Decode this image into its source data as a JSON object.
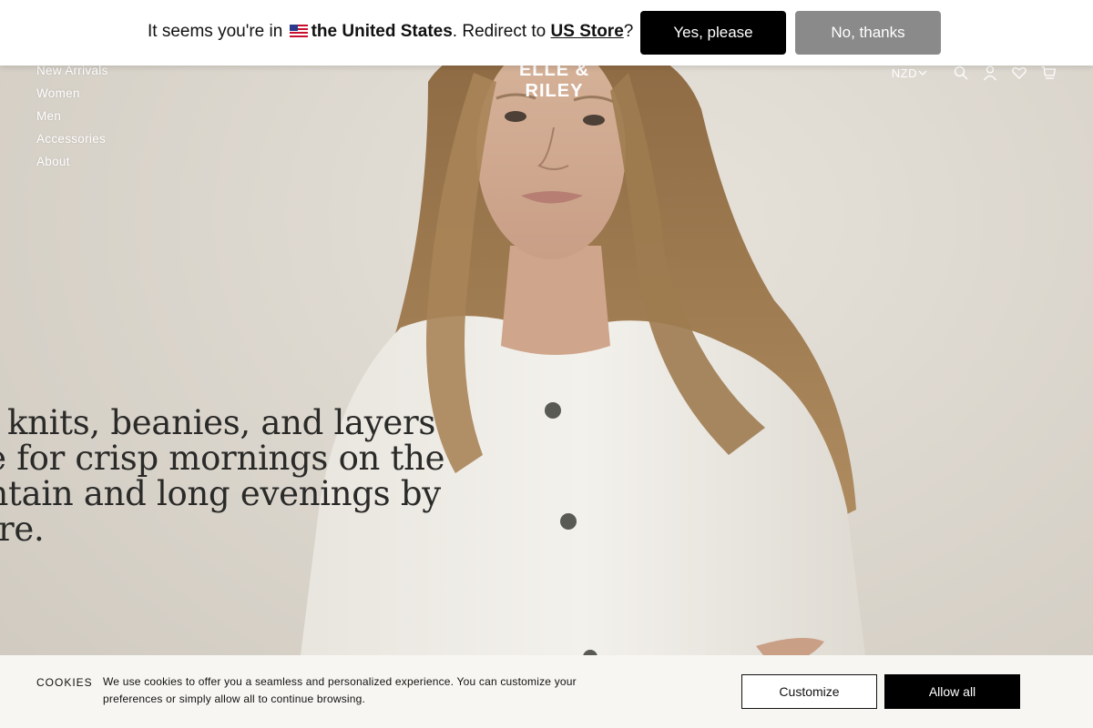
{
  "geo_banner": {
    "prefix": "It seems you're in",
    "country": "the United States",
    "middle": ". Redirect to",
    "store_link": "US Store",
    "suffix": "?",
    "yes_label": "Yes, please",
    "no_label": "No, thanks",
    "flag_icon": "us-flag-icon"
  },
  "header": {
    "logo": "ELLE & RILEY",
    "nav": [
      "New Arrivals",
      "Women",
      "Men",
      "Accessories",
      "About"
    ],
    "currency": "NZD",
    "icons": [
      "chevron-down-icon",
      "search-icon",
      "account-icon",
      "wishlist-heart-icon",
      "cart-icon"
    ]
  },
  "hero": {
    "headline_lines": [
      "ble knits, beanies, and layers",
      "ade for crisp mornings on the",
      "ountain and long evenings by",
      "e fire."
    ]
  },
  "cookies": {
    "title": "COOKIES",
    "text": "We use cookies to offer you a seamless and personalized experience. You can customize your preferences or simply allow all to continue browsing.",
    "customize_label": "Customize",
    "allow_label": "Allow all"
  },
  "colors": {
    "banner_bg": "#ffffff",
    "yes_button": "#000000",
    "no_button": "#8a8a8a",
    "cookie_bg": "#f7f6f2",
    "hero_bg": "#dcd7ce"
  }
}
